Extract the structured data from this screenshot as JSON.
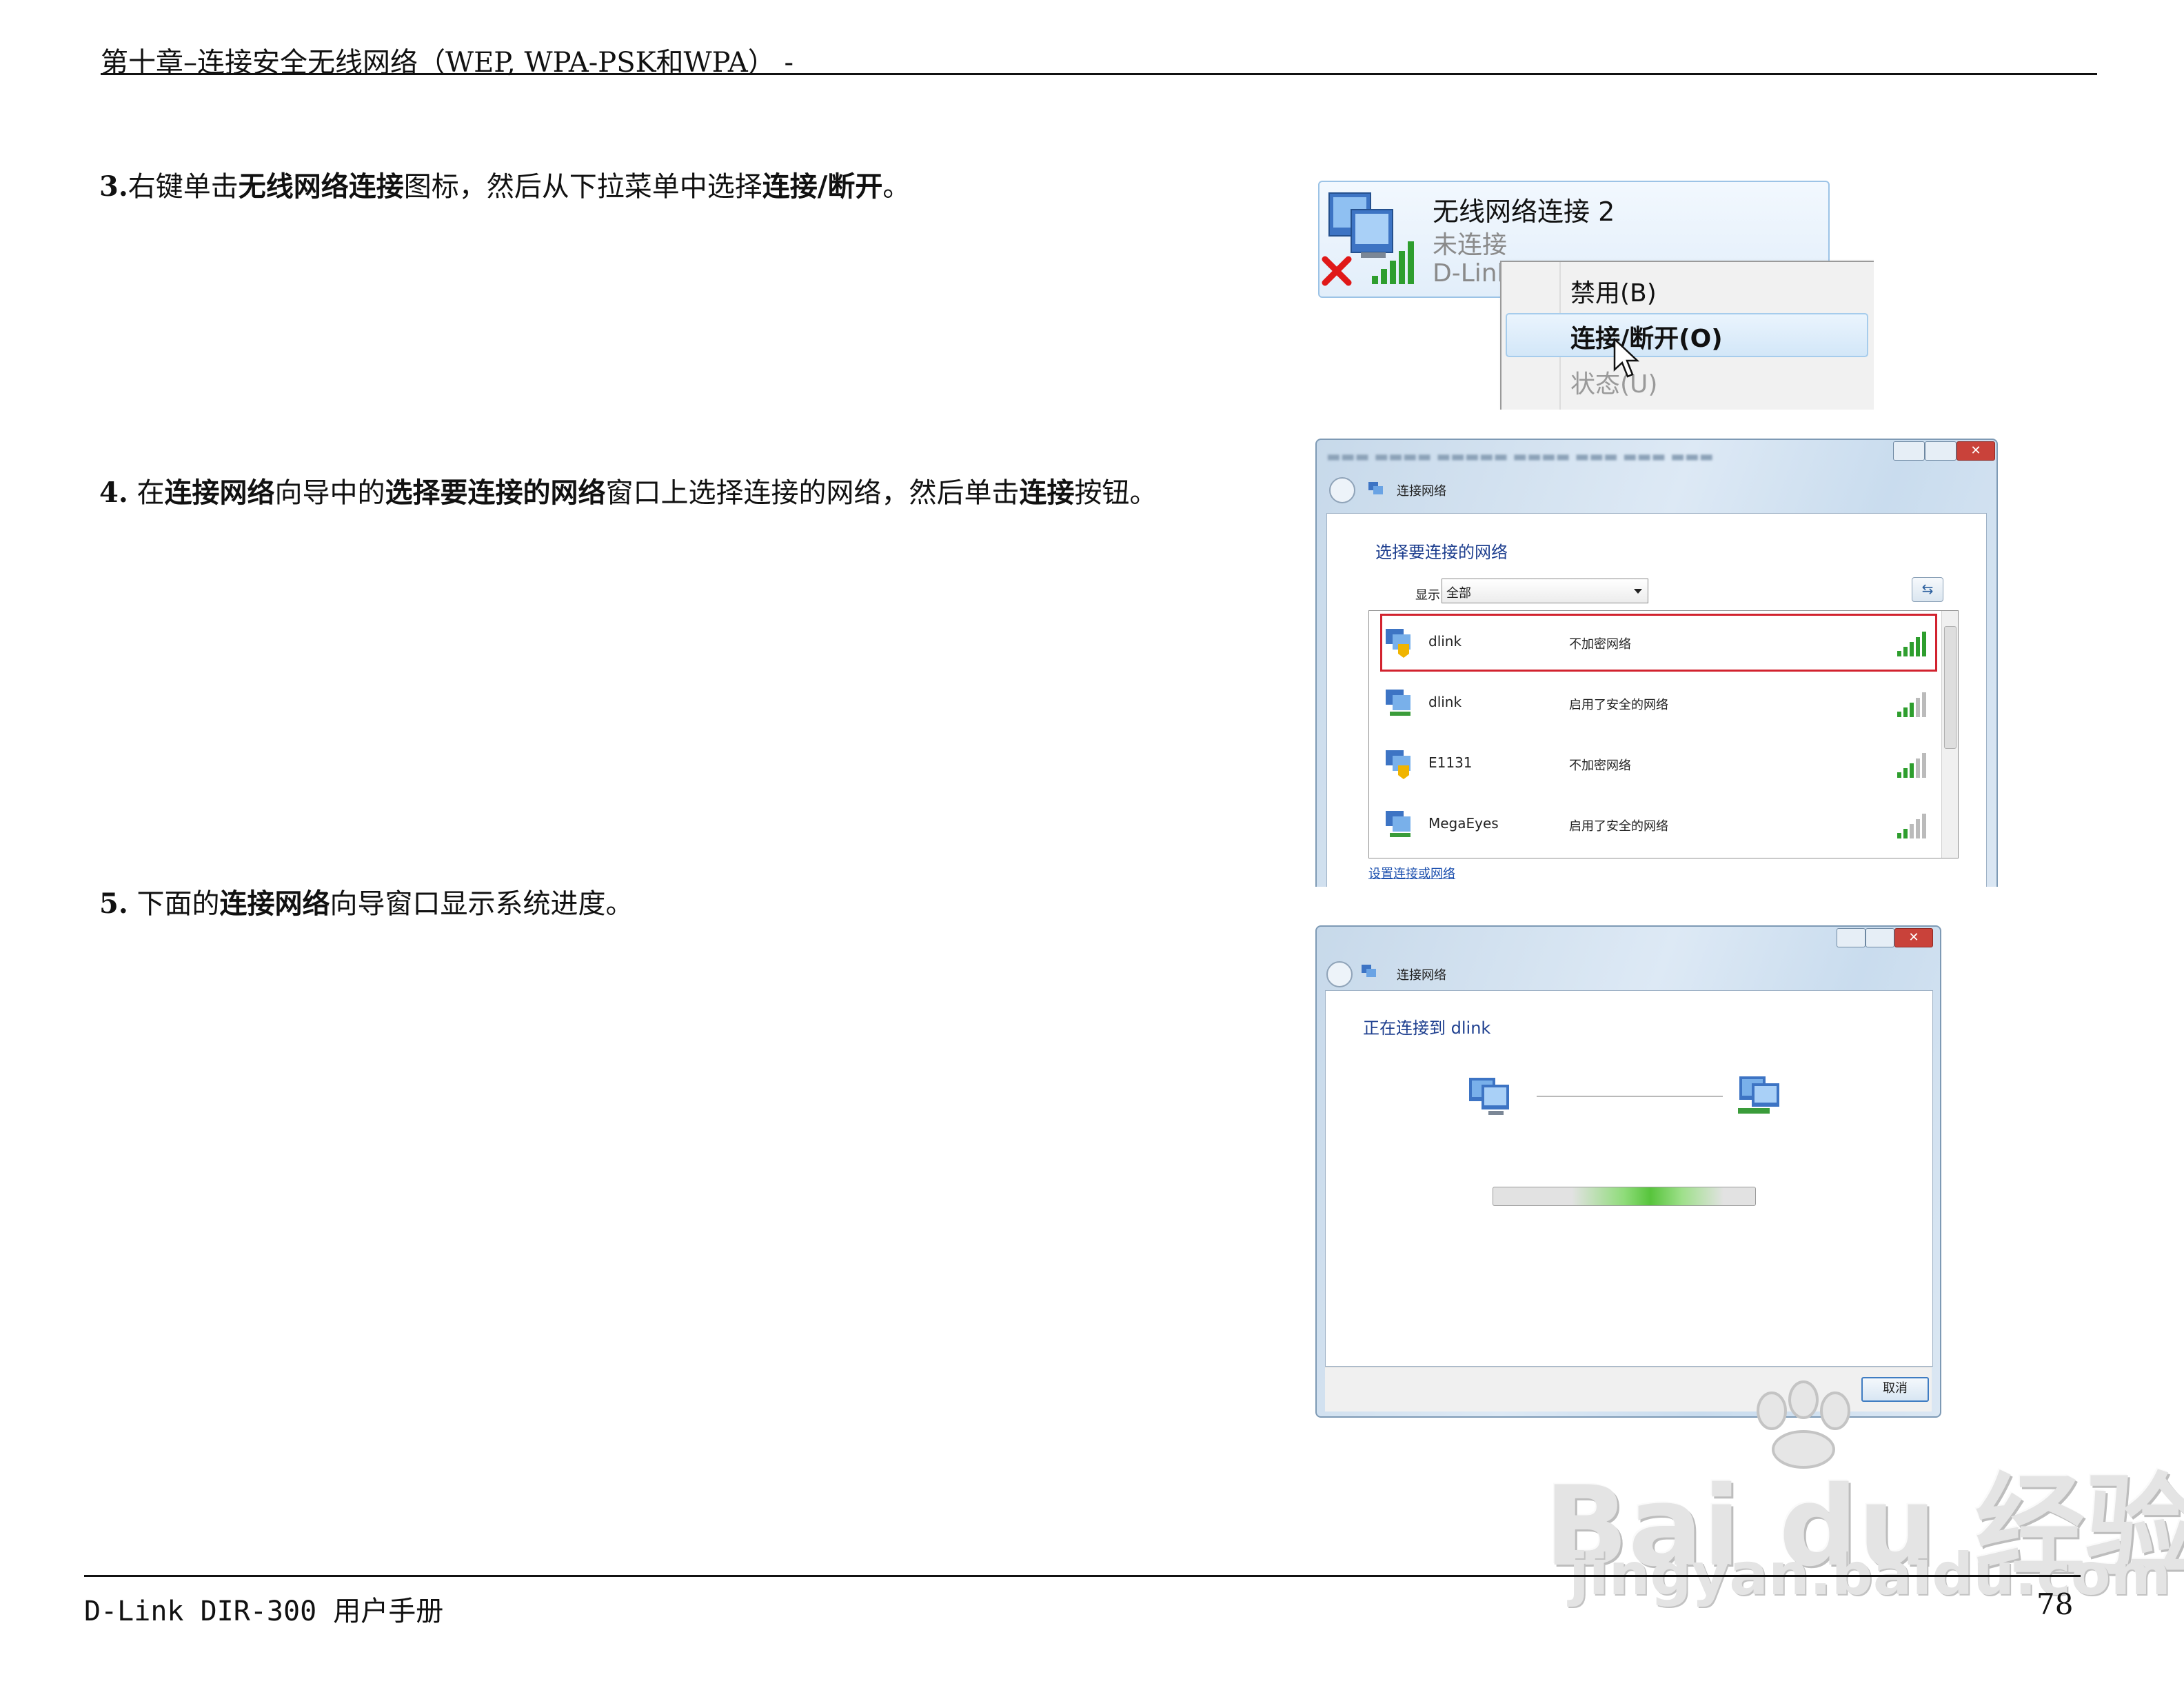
{
  "header": {
    "title": "第十章–连接安全无线网络（WEP, WPA-PSK和WPA）  -"
  },
  "steps": {
    "s3": {
      "num": "3.",
      "t1": "右键单击",
      "b1": "无线网络连接",
      "t2": "图标，然后从下拉菜单中选择",
      "b2": "连接/断开",
      "t3": "。"
    },
    "s4": {
      "num": "4.",
      "t0": " 在",
      "b1": "连接网络",
      "t1": "向导中的",
      "b2": "选择要连接的网络",
      "t2": "窗口上选择连接的网络，然后单击",
      "b3": "连接",
      "t3": "按钮。"
    },
    "s5": {
      "num": "5.",
      "t0": " 下面的",
      "b1": "连接网络",
      "t1": "向导窗口显示系统进度。"
    }
  },
  "screenshot1": {
    "tooltip_title": "无线网络连接 2",
    "status": "未连接",
    "ssid": "D-Link",
    "menu": {
      "disable": "禁用(B)",
      "connect": "连接/断开(O)",
      "status": "状态(U)"
    },
    "icons": [
      "network-computer-icon",
      "red-x-icon",
      "signal-bars-icon",
      "mouse-cursor-icon"
    ]
  },
  "screenshot2": {
    "nav_title": "连接网络",
    "heading": "选择要连接的网络",
    "show_label": "显示",
    "show_value": "全部",
    "networks": [
      {
        "name": "dlink",
        "status": "不加密网络",
        "selected": true
      },
      {
        "name": "dlink",
        "status": "启用了安全的网络",
        "selected": false
      },
      {
        "name": "E1131",
        "status": "不加密网络",
        "selected": false
      },
      {
        "name": "MegaEyes",
        "status": "启用了安全的网络",
        "selected": false
      }
    ],
    "link": "设置连接或网络",
    "selection_color": "#d2222e"
  },
  "screenshot3": {
    "nav_title": "连接网络",
    "heading": "正在连接到 dlink",
    "cancel": "取消",
    "progress_color": "#57c43c"
  },
  "footer": {
    "left": "D-Link DIR-300 用户手册",
    "page": "78"
  },
  "watermark": {
    "brand": "Bai du 经验",
    "url": "jingyan.baidu.com"
  }
}
